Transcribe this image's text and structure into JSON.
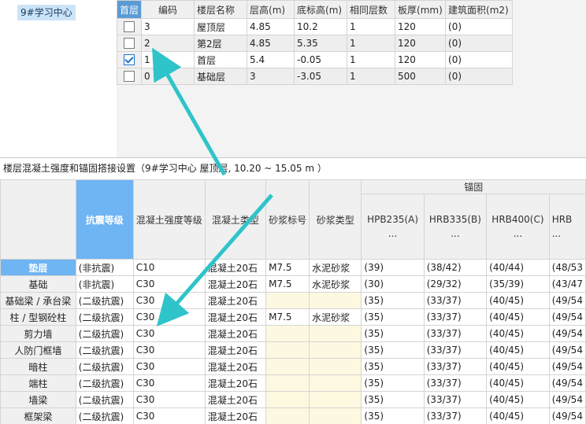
{
  "tree": {
    "selected_node": "9#学习中心"
  },
  "floor_table": {
    "headers": [
      "首层",
      "编码",
      "楼层名称",
      "层高(m)",
      "底标高(m)",
      "相同层数",
      "板厚(mm)",
      "建筑面积(m2)"
    ],
    "rows": [
      {
        "checked": false,
        "code": "3",
        "name": "屋顶层",
        "height": "4.85",
        "bottom": "10.2",
        "same": "1",
        "thick": "120",
        "area": "(0)"
      },
      {
        "checked": false,
        "code": "2",
        "name": "第2层",
        "height": "4.85",
        "bottom": "5.35",
        "same": "1",
        "thick": "120",
        "area": "(0)"
      },
      {
        "checked": true,
        "code": "1",
        "name": "首层",
        "height": "5.4",
        "bottom": "-0.05",
        "same": "1",
        "thick": "120",
        "area": "(0)"
      },
      {
        "checked": false,
        "code": "0",
        "name": "基础层",
        "height": "3",
        "bottom": "-3.05",
        "same": "1",
        "thick": "500",
        "area": "(0)"
      }
    ]
  },
  "section_title": "楼层混凝土强度和锚固搭接设置（9#学习中心  屋顶层, 10.20 ~ 15.05 m ）",
  "concrete_table": {
    "headers": {
      "seismic": "抗震等级",
      "strength": "混凝土强度等级",
      "type": "混凝土类型",
      "mortar_grade": "砂浆标号",
      "mortar_type": "砂浆类型",
      "anchor_group": "锚固",
      "rebar": [
        "HPB235(A)",
        "HRB335(B)",
        "HRB400(C)",
        "HRB"
      ],
      "ellipsis": "..."
    },
    "rows": [
      {
        "name": "垫层",
        "seismic": "(非抗震)",
        "strength": "C10",
        "type": "混凝土20石",
        "mortar_grade": "M7.5",
        "mortar_type": "水泥砂浆",
        "a": "(39)",
        "b": "(38/42)",
        "c": "(40/44)",
        "d": "(48/53"
      },
      {
        "name": "基础",
        "seismic": "(非抗震)",
        "strength": "C30",
        "type": "混凝土20石",
        "mortar_grade": "M7.5",
        "mortar_type": "水泥砂浆",
        "a": "(30)",
        "b": "(29/32)",
        "c": "(35/39)",
        "d": "(43/47"
      },
      {
        "name": "基础梁 / 承台梁",
        "seismic": "(二级抗震)",
        "strength": "C30",
        "type": "混凝土20石",
        "mortar_grade": "",
        "mortar_type": "",
        "a": "(35)",
        "b": "(33/37)",
        "c": "(40/45)",
        "d": "(49/54"
      },
      {
        "name": "柱 / 型钢砼柱",
        "seismic": "(二级抗震)",
        "strength": "C30",
        "type": "混凝土20石",
        "mortar_grade": "M7.5",
        "mortar_type": "水泥砂浆",
        "a": "(35)",
        "b": "(33/37)",
        "c": "(40/45)",
        "d": "(49/54"
      },
      {
        "name": "剪力墙",
        "seismic": "(二级抗震)",
        "strength": "C30",
        "type": "混凝土20石",
        "mortar_grade": "",
        "mortar_type": "",
        "a": "(35)",
        "b": "(33/37)",
        "c": "(40/45)",
        "d": "(49/54"
      },
      {
        "name": "人防门框墙",
        "seismic": "(二级抗震)",
        "strength": "C30",
        "type": "混凝土20石",
        "mortar_grade": "",
        "mortar_type": "",
        "a": "(35)",
        "b": "(33/37)",
        "c": "(40/45)",
        "d": "(49/54"
      },
      {
        "name": "暗柱",
        "seismic": "(二级抗震)",
        "strength": "C30",
        "type": "混凝土20石",
        "mortar_grade": "",
        "mortar_type": "",
        "a": "(35)",
        "b": "(33/37)",
        "c": "(40/45)",
        "d": "(49/54"
      },
      {
        "name": "端柱",
        "seismic": "(二级抗震)",
        "strength": "C30",
        "type": "混凝土20石",
        "mortar_grade": "",
        "mortar_type": "",
        "a": "(35)",
        "b": "(33/37)",
        "c": "(40/45)",
        "d": "(49/54"
      },
      {
        "name": "墙梁",
        "seismic": "(二级抗震)",
        "strength": "C30",
        "type": "混凝土20石",
        "mortar_grade": "",
        "mortar_type": "",
        "a": "(35)",
        "b": "(33/37)",
        "c": "(40/45)",
        "d": "(49/54"
      },
      {
        "name": "框架梁",
        "seismic": "(二级抗震)",
        "strength": "C30",
        "type": "混凝土20石",
        "mortar_grade": "",
        "mortar_type": "",
        "a": "(35)",
        "b": "(33/37)",
        "c": "(40/45)",
        "d": "(49/54"
      }
    ]
  },
  "colors": {
    "accent": "#5b9bd5",
    "arrow": "#2ec4c9",
    "highlight": "#6fb4f3"
  }
}
